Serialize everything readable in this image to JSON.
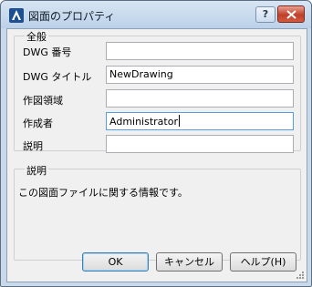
{
  "window": {
    "title": "図面のプロパティ",
    "help_button": "?",
    "close_icon": "close-icon"
  },
  "general": {
    "legend": "全般",
    "fields": [
      {
        "label": "DWG 番号",
        "value": ""
      },
      {
        "label": "DWG タイトル",
        "value": "NewDrawing"
      },
      {
        "label": "作図領域",
        "value": ""
      },
      {
        "label": "作成者",
        "value": "Administrator"
      },
      {
        "label": "説明",
        "value": ""
      }
    ]
  },
  "description": {
    "legend": "説明",
    "text": "この図面ファイルに関する情報です。"
  },
  "buttons": {
    "ok": "OK",
    "cancel": "キャンセル",
    "help": "ヘルプ(H)"
  }
}
